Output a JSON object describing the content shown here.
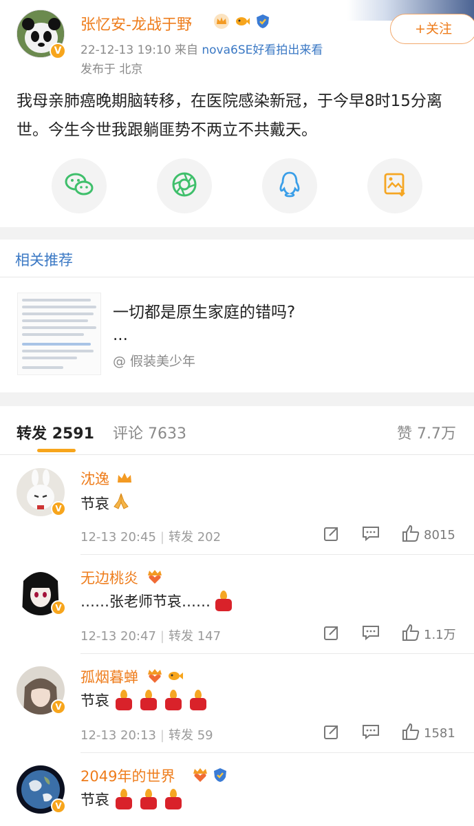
{
  "post": {
    "author": "张忆安-龙战于野",
    "follow_label": "+关注",
    "meta_time": "22-12-13 19:10",
    "meta_from": "来自",
    "meta_device": "nova6SE",
    "meta_device_suffix": "好看拍出来看",
    "location": "发布于 北京",
    "text": "我母亲肺癌晚期脑转移，在医院感染新冠，于今早8时15分离世。今生今世我跟躺匪势不两立不共戴天。",
    "share_icons": [
      "wechat-icon",
      "moments-icon",
      "qq-icon",
      "save-image-icon"
    ]
  },
  "related": {
    "section_title": "相关推荐",
    "headline": "一切都是原生家庭的错吗?",
    "ellipsis": "...",
    "author": "@ 假装美少年"
  },
  "tabs": {
    "repost_label": "转发",
    "repost_count": "2591",
    "comment_label": "评论",
    "comment_count": "7633",
    "like_label": "赞",
    "like_count": "7.7万"
  },
  "comments": [
    {
      "name": "沈逸",
      "text": "节哀",
      "emoji": "pray",
      "time": "12-13 20:45",
      "repost_label": "转发",
      "repost": "202",
      "likes": "8015"
    },
    {
      "name": "无边桃炎",
      "text": "……张老师节哀……",
      "emoji": "candle",
      "time": "12-13 20:47",
      "repost_label": "转发",
      "repost": "147",
      "likes": "1.1万"
    },
    {
      "name": "孤烟暮蝉",
      "text": "节哀",
      "emoji": "candles-4",
      "time": "12-13 20:13",
      "repost_label": "转发",
      "repost": "59",
      "likes": "1581"
    },
    {
      "name": "2049年的世界",
      "text": "节哀",
      "emoji": "candles-3"
    }
  ],
  "colors": {
    "accent": "#ee7c1b",
    "link": "#3a78c4",
    "badge": "#f7a51c"
  }
}
